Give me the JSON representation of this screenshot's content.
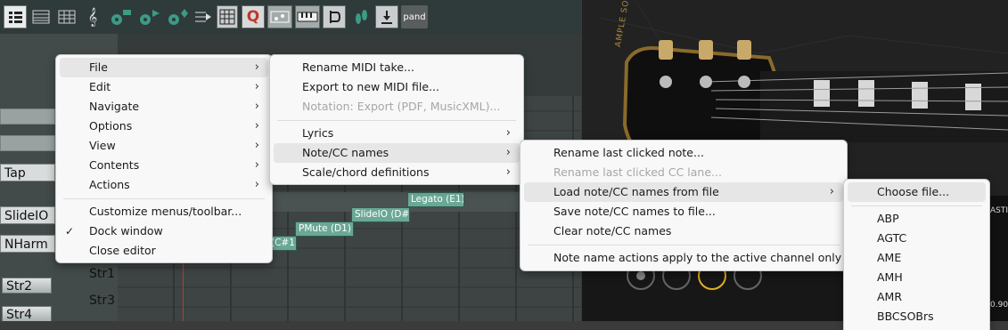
{
  "toolbar": {
    "buttons": [
      "lines-icon",
      "lines-icon",
      "grid-icon",
      "treble-clef-icon",
      "gear-icon",
      "gear-icon",
      "gear-icon",
      "playhead-icon",
      "grid-icon",
      "q-icon",
      "chord-icon",
      "keyboard-icon",
      "bracket-icon",
      "footprint-icon",
      "download-icon"
    ],
    "pand_label": "pand"
  },
  "piano_roll": {
    "lane_labels": [
      "Tap",
      "SlideIO",
      "NHarm"
    ],
    "string_labels": [
      "Str2",
      "Str4"
    ],
    "string_numbers": [
      "Str1",
      "Str3"
    ],
    "notes": [
      {
        "label": "Legato (E1)"
      },
      {
        "label": "SlideIO (D#1)"
      },
      {
        "label": "PMute (D1)"
      },
      {
        "label": "(C#1)"
      }
    ]
  },
  "menu_main": {
    "items": [
      {
        "label": "File",
        "submenu": true
      },
      {
        "label": "Edit",
        "submenu": true
      },
      {
        "label": "Navigate",
        "submenu": true
      },
      {
        "label": "Options",
        "submenu": true
      },
      {
        "label": "View",
        "submenu": true
      },
      {
        "label": "Contents",
        "submenu": true
      },
      {
        "label": "Actions",
        "submenu": true
      },
      {
        "label": "Customize menus/toolbar..."
      },
      {
        "label": "Dock window",
        "checked": true
      },
      {
        "label": "Close editor"
      }
    ]
  },
  "menu_file": {
    "items": [
      {
        "label": "Rename MIDI take..."
      },
      {
        "label": "Export to new MIDI file..."
      },
      {
        "label": "Notation: Export (PDF, MusicXML)...",
        "disabled": true
      },
      {
        "label": "Lyrics",
        "submenu": true
      },
      {
        "label": "Note/CC names",
        "submenu": true
      },
      {
        "label": "Scale/chord definitions",
        "submenu": true
      }
    ]
  },
  "menu_notecc": {
    "items": [
      {
        "label": "Rename last clicked note..."
      },
      {
        "label": "Rename last clicked CC lane...",
        "disabled": true
      },
      {
        "label": "Load note/CC names from file",
        "submenu": true
      },
      {
        "label": "Save note/CC names to file..."
      },
      {
        "label": "Clear note/CC names"
      },
      {
        "label": "Note name actions apply to the active channel only"
      }
    ]
  },
  "menu_load": {
    "items": [
      {
        "label": "Choose file..."
      },
      {
        "label": "ABP"
      },
      {
        "label": "AGTC"
      },
      {
        "label": "AME"
      },
      {
        "label": "AMH"
      },
      {
        "label": "AMR"
      },
      {
        "label": "BBCSOBrs"
      }
    ]
  },
  "vst": {
    "brand_text": "AMPLE SOUND",
    "side_text_top": "ASTI",
    "side_text_bottom": "0.90"
  },
  "colors": {
    "menu_bg": "#f8f8f8",
    "highlight": "#e6e6e6",
    "note_fill": "#6aa895"
  }
}
